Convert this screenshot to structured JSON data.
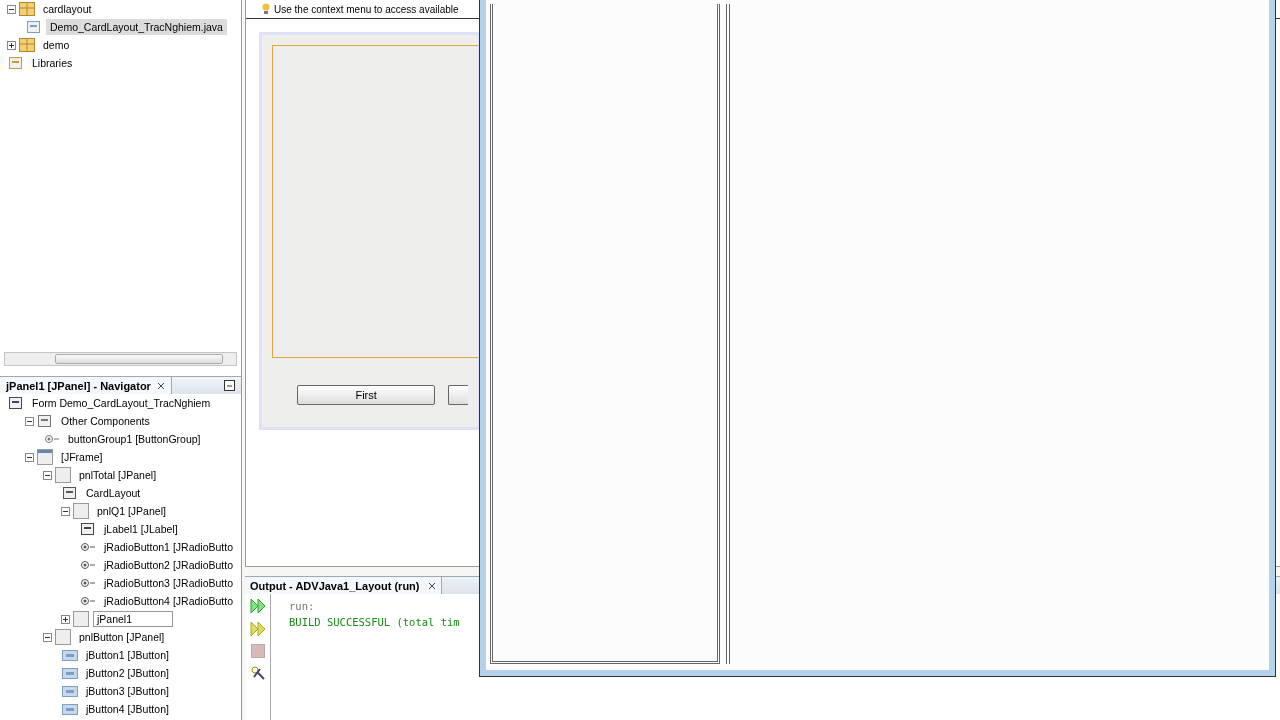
{
  "projects": {
    "items": [
      {
        "label": "cardlayout",
        "kind": "package",
        "expanded": true,
        "selected": false,
        "children": [
          {
            "label": "Demo_CardLayout_TracNghiem.java",
            "kind": "form-file",
            "selected": true
          }
        ]
      },
      {
        "label": "demo",
        "kind": "package",
        "expanded": false,
        "selected": false
      },
      {
        "label": "Libraries",
        "kind": "library",
        "selected": false
      }
    ]
  },
  "navigator": {
    "title": "jPanel1 [JPanel] - Navigator",
    "items": [
      {
        "label": "Form Demo_CardLayout_TracNghiem",
        "kind": "form",
        "children": [
          {
            "label": "Other Components",
            "kind": "other",
            "expanded": true,
            "children": [
              {
                "label": "buttonGroup1 [ButtonGroup]",
                "kind": "group"
              }
            ]
          },
          {
            "label": "[JFrame]",
            "kind": "frame",
            "expanded": true,
            "children": [
              {
                "label": "pnlTotal [JPanel]",
                "kind": "panel",
                "expanded": true,
                "children": [
                  {
                    "label": "CardLayout",
                    "kind": "layout"
                  },
                  {
                    "label": "pnlQ1 [JPanel]",
                    "kind": "panel",
                    "expanded": true,
                    "children": [
                      {
                        "label": "jLabel1 [JLabel]",
                        "kind": "label"
                      },
                      {
                        "label": "jRadioButton1 [JRadioButto",
                        "kind": "radio"
                      },
                      {
                        "label": "jRadioButton2 [JRadioButto",
                        "kind": "radio"
                      },
                      {
                        "label": "jRadioButton3 [JRadioButto",
                        "kind": "radio"
                      },
                      {
                        "label": "jRadioButton4 [JRadioButto",
                        "kind": "radio"
                      }
                    ]
                  },
                  {
                    "label": "jPanel1",
                    "kind": "panel",
                    "expanded": false,
                    "editing": true
                  }
                ]
              },
              {
                "label": "pnlButton [JPanel]",
                "kind": "panel",
                "expanded": true,
                "children": [
                  {
                    "label": "jButton1 [JButton]",
                    "kind": "button"
                  },
                  {
                    "label": "jButton2 [JButton]",
                    "kind": "button"
                  },
                  {
                    "label": "jButton3 [JButton]",
                    "kind": "button"
                  },
                  {
                    "label": "jButton4 [JButton]",
                    "kind": "button"
                  }
                ]
              }
            ]
          }
        ]
      }
    ]
  },
  "designer": {
    "hint": "Use the context menu to access available",
    "buttons": [
      "First"
    ]
  },
  "output": {
    "title": "Output - ADVJava1_Layout (run)",
    "lines": [
      {
        "text": "run:",
        "kind": "info"
      },
      {
        "text": "BUILD SUCCESSFUL (total tim",
        "kind": "success"
      }
    ]
  }
}
